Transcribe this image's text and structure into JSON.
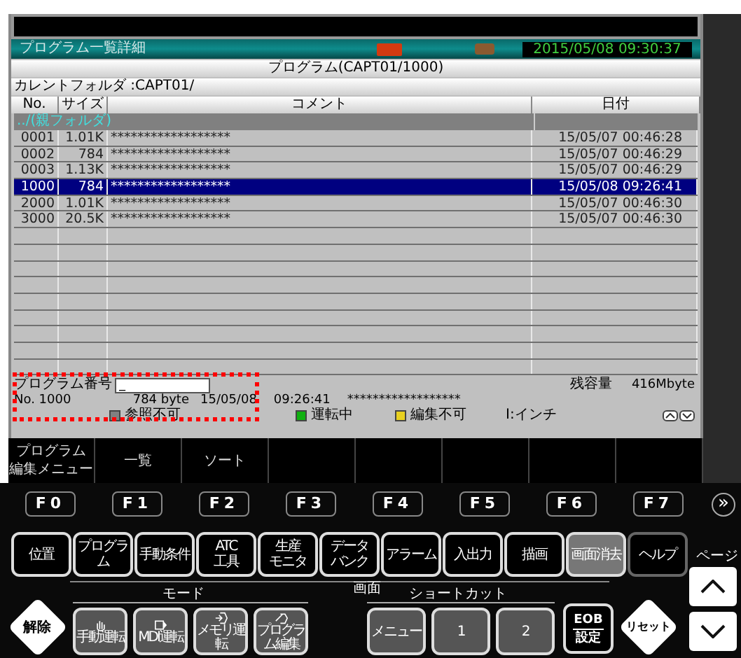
{
  "title_bar": {
    "title": "プログラム一覧詳細",
    "datetime": "2015/05/08 09:30:37"
  },
  "program_header": "プログラム(CAPT01/1000)",
  "current_folder": "カレントフォルダ :CAPT01/",
  "table": {
    "columns": [
      "No.",
      "サイズ",
      "コメント",
      "日付"
    ],
    "parent_folder": "../(親フォルダ)",
    "rows": [
      {
        "no": "0001",
        "size": "1.01K",
        "comment": "******************",
        "date": "15/05/07 00:46:28",
        "selected": false
      },
      {
        "no": "0002",
        "size": "784",
        "comment": "******************",
        "date": "15/05/07 00:46:29",
        "selected": false
      },
      {
        "no": "0003",
        "size": "1.13K",
        "comment": "******************",
        "date": "15/05/07 00:46:29",
        "selected": false
      },
      {
        "no": "1000",
        "size": "784",
        "comment": "******************",
        "date": "15/05/08 09:26:41",
        "selected": true
      },
      {
        "no": "2000",
        "size": "1.01K",
        "comment": "******************",
        "date": "15/05/07 00:46:30",
        "selected": false
      },
      {
        "no": "3000",
        "size": "20.5K",
        "comment": "******************",
        "date": "15/05/07 00:46:30",
        "selected": false
      }
    ]
  },
  "info": {
    "program_number_label": "プログラム番号",
    "program_number_value": "_",
    "capacity_label": "残容量",
    "capacity": "416Mbyte",
    "no": "No. 1000",
    "size": "784 byte",
    "date": "15/05/08",
    "time": "09:26:41",
    "comment": "******************"
  },
  "status": [
    {
      "label": "参照不可",
      "color": "#808080"
    },
    {
      "label": "運転中",
      "color": "#10b010"
    },
    {
      "label": "編集不可",
      "color": "#e8d020"
    }
  ],
  "unit": "I:インチ",
  "softkeys": [
    {
      "lines": [
        "プログラム",
        "編集メニュー"
      ]
    },
    {
      "lines": [
        "一覧"
      ]
    },
    {
      "lines": [
        "ソート"
      ]
    }
  ],
  "fkeys": [
    "F0",
    "F1",
    "F2",
    "F3",
    "F4",
    "F5",
    "F6",
    "F7"
  ],
  "more": "»",
  "panel_buttons": [
    {
      "lines": [
        "位置"
      ],
      "kind": "key"
    },
    {
      "lines": [
        "プログラム"
      ],
      "kind": "key"
    },
    {
      "lines": [
        "手動条件"
      ],
      "kind": "key"
    },
    {
      "lines": [
        "ATC",
        "工具"
      ],
      "kind": "key"
    },
    {
      "lines": [
        "生産",
        "モニタ"
      ],
      "kind": "key"
    },
    {
      "lines": [
        "データ",
        "バンク"
      ],
      "kind": "key"
    },
    {
      "lines": [
        "アラーム"
      ],
      "kind": "key"
    },
    {
      "lines": [
        "入出力"
      ],
      "kind": "key"
    },
    {
      "lines": [
        "描画"
      ],
      "kind": "key"
    },
    {
      "lines": [
        "画面消去"
      ],
      "kind": "active"
    },
    {
      "lines": [
        "ヘルプ"
      ],
      "kind": "help"
    }
  ],
  "screen_label": "画面",
  "release": "解除",
  "mode": {
    "label": "モード",
    "buttons": [
      "手動運転",
      "MDI運転",
      "メモリ運転",
      "プログラム編集"
    ]
  },
  "shortcut": {
    "label": "ショートカット",
    "buttons": [
      "メニュー",
      "1",
      "2"
    ]
  },
  "eob": {
    "top": "EOB",
    "bottom": "設定"
  },
  "reset": "リセット",
  "page": "ページ"
}
